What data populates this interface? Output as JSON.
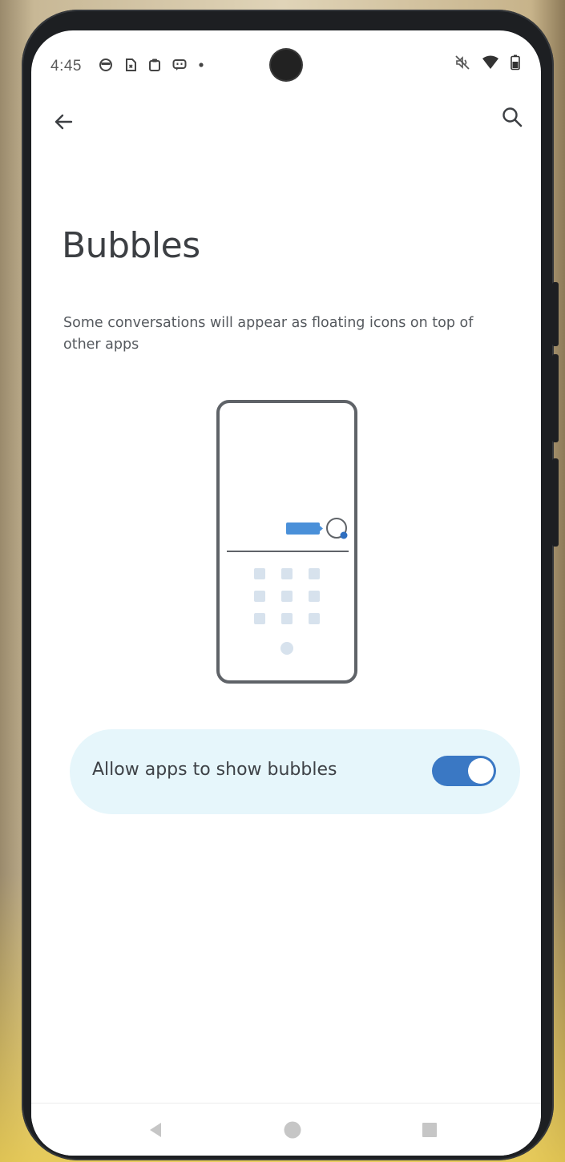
{
  "status_bar": {
    "time": "4:45",
    "left_icons": [
      "media-icon",
      "sim-icon",
      "clipboard-icon",
      "chat-icon",
      "dot-icon"
    ],
    "right_icons": [
      "silent-icon",
      "wifi-icon",
      "battery-icon"
    ]
  },
  "toolbar": {
    "back_icon": "arrow-left-icon",
    "search_icon": "search-icon"
  },
  "page": {
    "title": "Bubbles",
    "description": "Some conversations will appear as floating icons on top of other apps"
  },
  "setting": {
    "label": "Allow apps to show bubbles",
    "enabled": true
  },
  "nav": {
    "items": [
      "back-triangle-icon",
      "home-circle-icon",
      "recents-square-icon"
    ]
  },
  "colors": {
    "accent": "#3a78c4",
    "card_bg": "#e6f6fb",
    "bubble_blue": "#4a90d9"
  }
}
